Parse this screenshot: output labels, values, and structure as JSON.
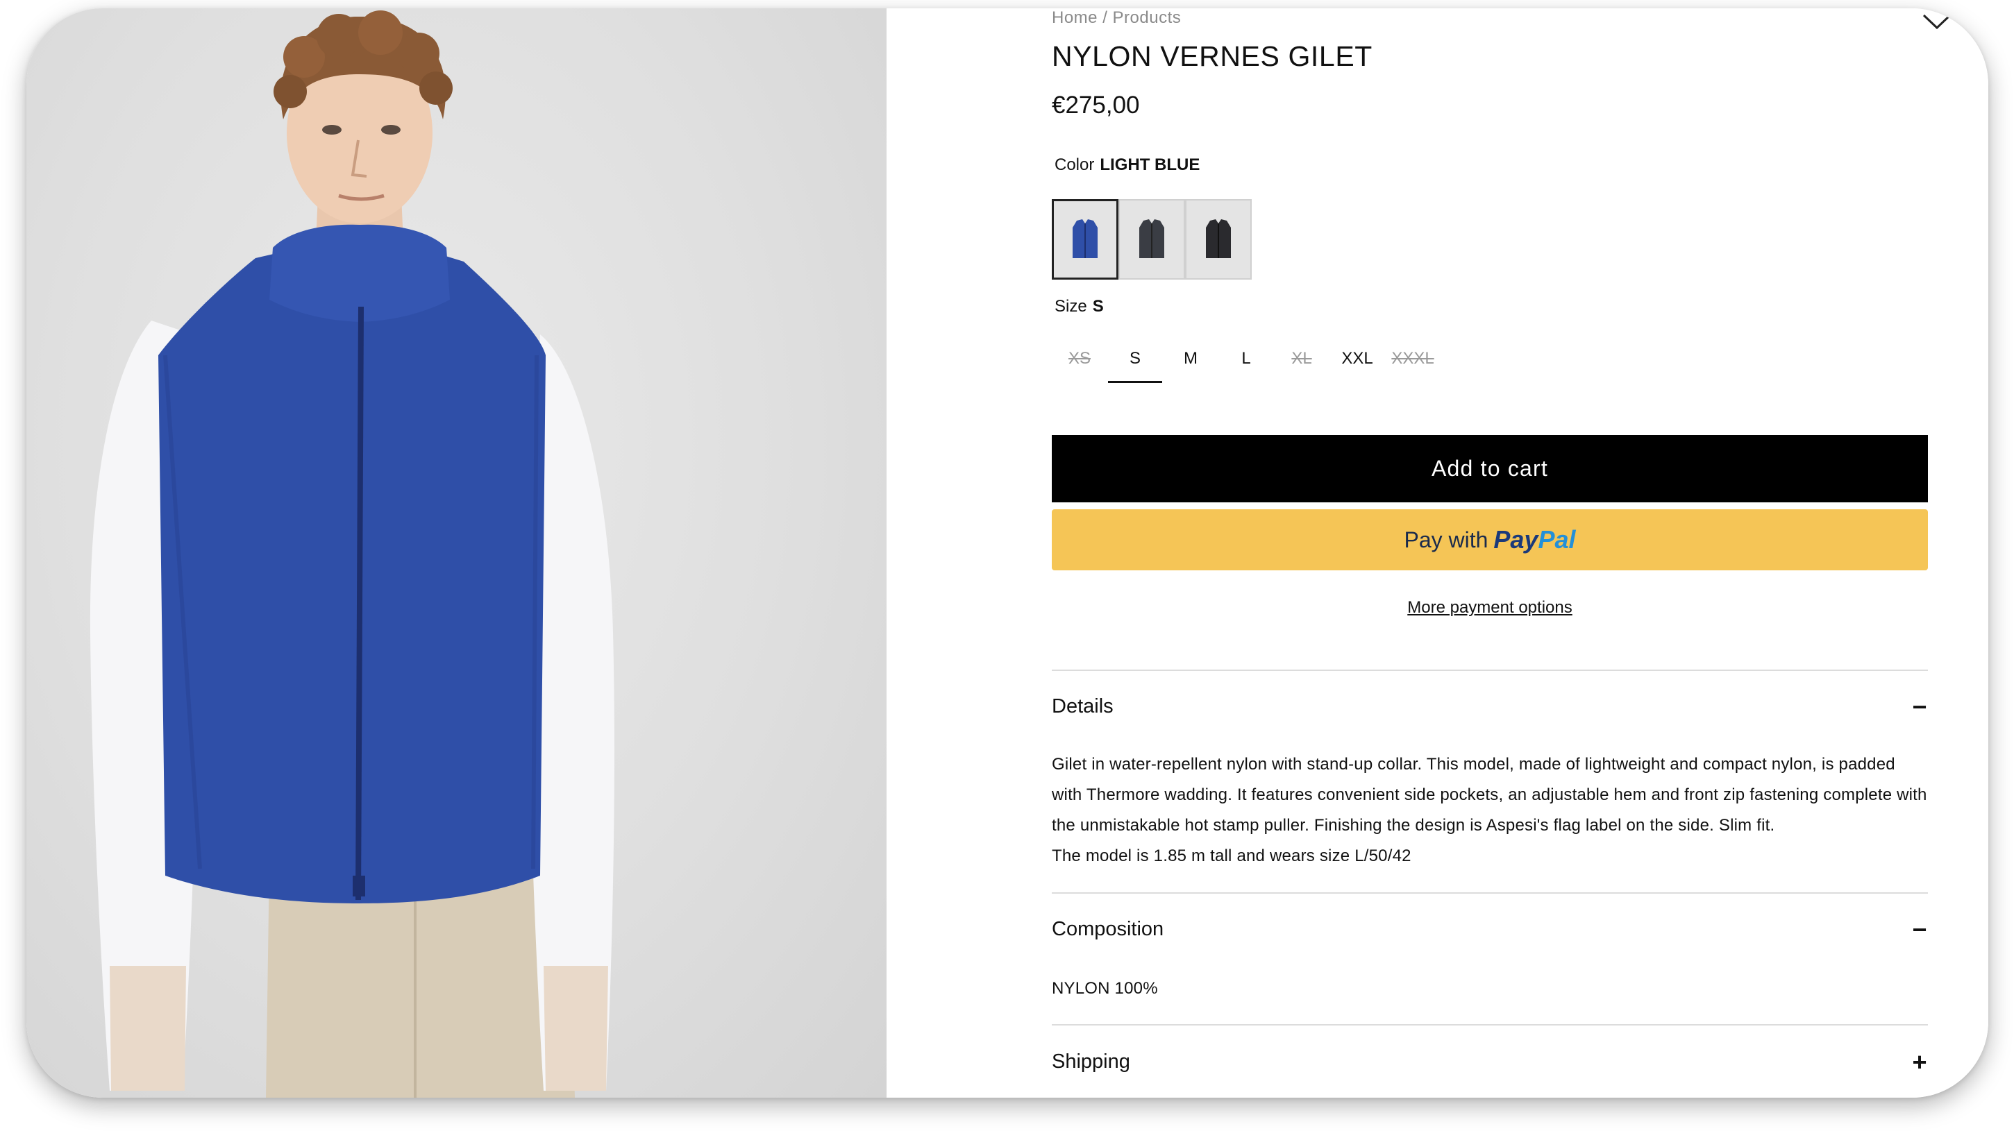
{
  "breadcrumb": "Home / Products",
  "product": {
    "title": "NYLON VERNES GILET",
    "price": "€275,00"
  },
  "color": {
    "label": "Color",
    "selected": "LIGHT BLUE",
    "swatches": [
      {
        "name": "light-blue",
        "hex": "#2f4fa8"
      },
      {
        "name": "charcoal",
        "hex": "#3a3d44"
      },
      {
        "name": "black",
        "hex": "#2a2a2e"
      }
    ]
  },
  "size": {
    "label": "Size",
    "selected": "S",
    "options": [
      {
        "label": "XS",
        "available": false
      },
      {
        "label": "S",
        "available": true
      },
      {
        "label": "M",
        "available": true
      },
      {
        "label": "L",
        "available": true
      },
      {
        "label": "XL",
        "available": false
      },
      {
        "label": "XXL",
        "available": true
      },
      {
        "label": "XXXL",
        "available": false
      }
    ]
  },
  "buttons": {
    "add_to_cart": "Add to cart",
    "pay_with": "Pay with",
    "paypal_pay": "Pay",
    "paypal_pal": "Pal",
    "more_payment": "More payment options"
  },
  "accordion": {
    "details": {
      "title": "Details",
      "icon": "minus-icon",
      "text1": "Gilet in water-repellent nylon with stand-up collar. This model, made of lightweight and compact nylon, is padded with Thermore wadding. It features convenient side pockets, an adjustable hem and front zip fastening complete with the unmistakable hot stamp puller. Finishing the design is Aspesi's flag label on the side. Slim fit.",
      "text2": "The model is 1.85 m tall and wears size L/50/42"
    },
    "composition": {
      "title": "Composition",
      "icon": "minus-icon",
      "text": "NYLON 100%"
    },
    "shipping": {
      "title": "Shipping",
      "icon": "plus-icon"
    }
  },
  "colors": {
    "accent_black": "#000000",
    "paypal_yellow": "#f5c556",
    "vest_blue": "#2f4fa8"
  }
}
